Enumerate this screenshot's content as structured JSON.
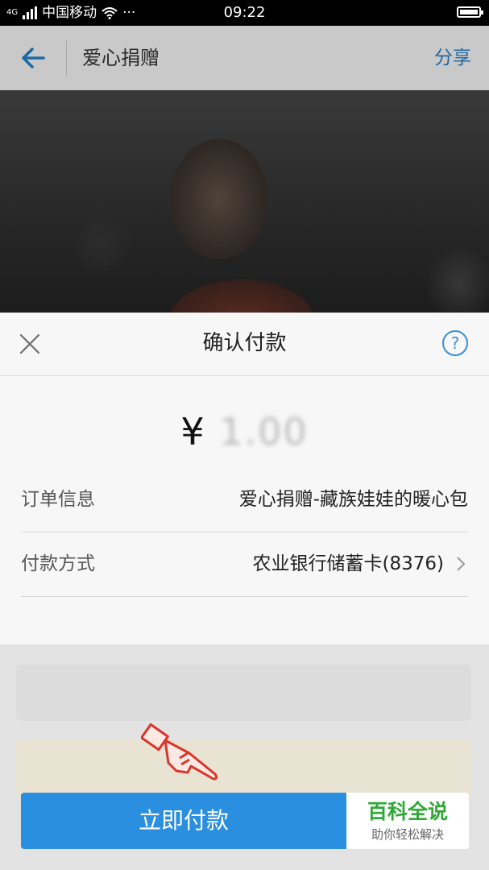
{
  "status_bar": {
    "network": "4G",
    "carrier": "中国移动",
    "dots": "···",
    "time": "09:22"
  },
  "header": {
    "title": "爱心捐赠",
    "share_label": "分享",
    "back_icon": "back-arrow-icon"
  },
  "sheet": {
    "title": "确认付款",
    "close_icon": "close-icon",
    "help_icon": "help-icon",
    "help_glyph": "?",
    "amount_symbol": "¥",
    "amount_obscured": "1.00",
    "rows": [
      {
        "label": "订单信息",
        "value": "爱心捐赠-藏族娃娃的暖心包"
      },
      {
        "label": "付款方式",
        "value": "农业银行储蓄卡(8376)"
      }
    ]
  },
  "pay_button": {
    "label": "立即付款"
  },
  "watermark": {
    "title": "百科全说",
    "subtitle": "助你轻松解决"
  },
  "colors": {
    "accent_blue": "#2b8fe0",
    "header_link": "#1d6aa3",
    "watermark_green": "#2fa836",
    "pointer_red": "#d9362b"
  }
}
